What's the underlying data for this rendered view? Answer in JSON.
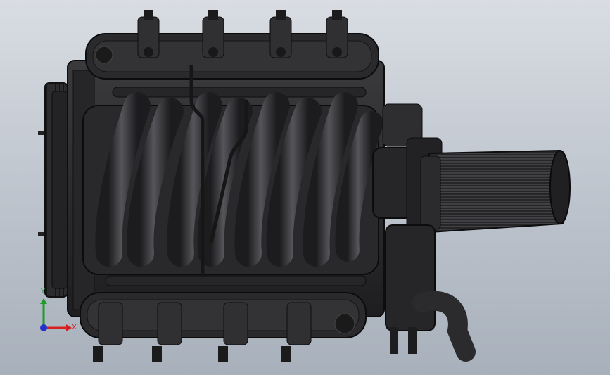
{
  "viewport": {
    "background_top": "#d9dde3",
    "background_bottom": "#a8b0bb"
  },
  "model": {
    "base_color": "#2b2b2d",
    "dark_color": "#161617",
    "highlight_color": "#5a5a5e",
    "runner_count": 8,
    "coil_count_top": 4,
    "coil_count_bottom": 4
  },
  "triad": {
    "x_label": "X",
    "y_label": "Y",
    "x_color": "#d62020",
    "y_color": "#1f9a2e",
    "z_color": "#2233cc"
  }
}
